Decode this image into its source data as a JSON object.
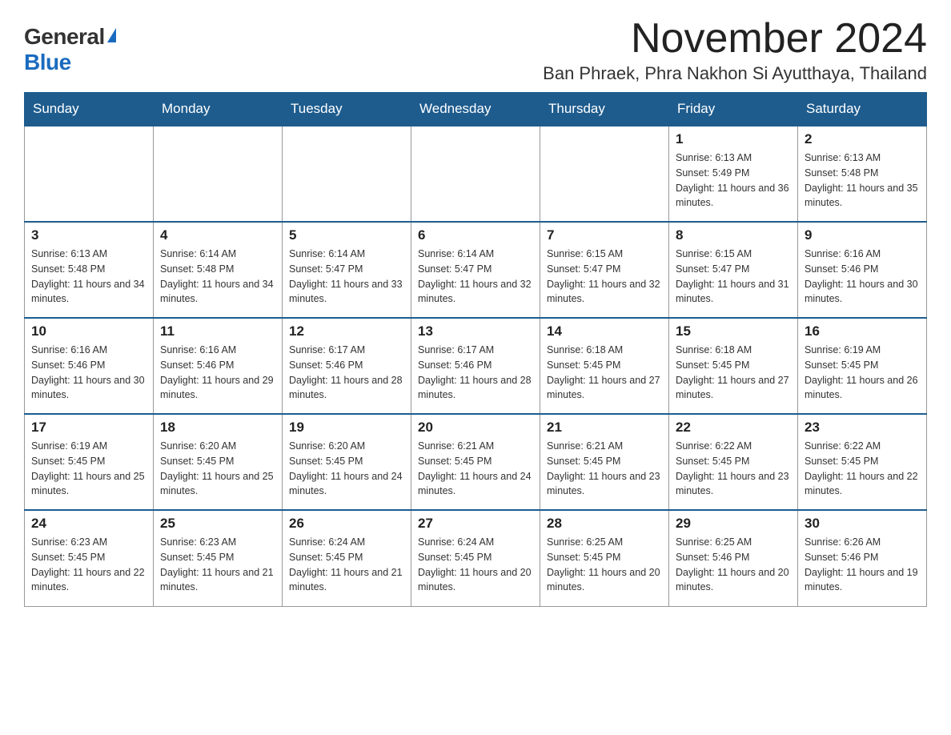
{
  "header": {
    "logo_general": "General",
    "logo_blue": "Blue",
    "month_title": "November 2024",
    "location": "Ban Phraek, Phra Nakhon Si Ayutthaya, Thailand"
  },
  "days_of_week": [
    "Sunday",
    "Monday",
    "Tuesday",
    "Wednesday",
    "Thursday",
    "Friday",
    "Saturday"
  ],
  "weeks": [
    {
      "days": [
        {
          "num": "",
          "info": ""
        },
        {
          "num": "",
          "info": ""
        },
        {
          "num": "",
          "info": ""
        },
        {
          "num": "",
          "info": ""
        },
        {
          "num": "",
          "info": ""
        },
        {
          "num": "1",
          "info": "Sunrise: 6:13 AM\nSunset: 5:49 PM\nDaylight: 11 hours and 36 minutes."
        },
        {
          "num": "2",
          "info": "Sunrise: 6:13 AM\nSunset: 5:48 PM\nDaylight: 11 hours and 35 minutes."
        }
      ]
    },
    {
      "days": [
        {
          "num": "3",
          "info": "Sunrise: 6:13 AM\nSunset: 5:48 PM\nDaylight: 11 hours and 34 minutes."
        },
        {
          "num": "4",
          "info": "Sunrise: 6:14 AM\nSunset: 5:48 PM\nDaylight: 11 hours and 34 minutes."
        },
        {
          "num": "5",
          "info": "Sunrise: 6:14 AM\nSunset: 5:47 PM\nDaylight: 11 hours and 33 minutes."
        },
        {
          "num": "6",
          "info": "Sunrise: 6:14 AM\nSunset: 5:47 PM\nDaylight: 11 hours and 32 minutes."
        },
        {
          "num": "7",
          "info": "Sunrise: 6:15 AM\nSunset: 5:47 PM\nDaylight: 11 hours and 32 minutes."
        },
        {
          "num": "8",
          "info": "Sunrise: 6:15 AM\nSunset: 5:47 PM\nDaylight: 11 hours and 31 minutes."
        },
        {
          "num": "9",
          "info": "Sunrise: 6:16 AM\nSunset: 5:46 PM\nDaylight: 11 hours and 30 minutes."
        }
      ]
    },
    {
      "days": [
        {
          "num": "10",
          "info": "Sunrise: 6:16 AM\nSunset: 5:46 PM\nDaylight: 11 hours and 30 minutes."
        },
        {
          "num": "11",
          "info": "Sunrise: 6:16 AM\nSunset: 5:46 PM\nDaylight: 11 hours and 29 minutes."
        },
        {
          "num": "12",
          "info": "Sunrise: 6:17 AM\nSunset: 5:46 PM\nDaylight: 11 hours and 28 minutes."
        },
        {
          "num": "13",
          "info": "Sunrise: 6:17 AM\nSunset: 5:46 PM\nDaylight: 11 hours and 28 minutes."
        },
        {
          "num": "14",
          "info": "Sunrise: 6:18 AM\nSunset: 5:45 PM\nDaylight: 11 hours and 27 minutes."
        },
        {
          "num": "15",
          "info": "Sunrise: 6:18 AM\nSunset: 5:45 PM\nDaylight: 11 hours and 27 minutes."
        },
        {
          "num": "16",
          "info": "Sunrise: 6:19 AM\nSunset: 5:45 PM\nDaylight: 11 hours and 26 minutes."
        }
      ]
    },
    {
      "days": [
        {
          "num": "17",
          "info": "Sunrise: 6:19 AM\nSunset: 5:45 PM\nDaylight: 11 hours and 25 minutes."
        },
        {
          "num": "18",
          "info": "Sunrise: 6:20 AM\nSunset: 5:45 PM\nDaylight: 11 hours and 25 minutes."
        },
        {
          "num": "19",
          "info": "Sunrise: 6:20 AM\nSunset: 5:45 PM\nDaylight: 11 hours and 24 minutes."
        },
        {
          "num": "20",
          "info": "Sunrise: 6:21 AM\nSunset: 5:45 PM\nDaylight: 11 hours and 24 minutes."
        },
        {
          "num": "21",
          "info": "Sunrise: 6:21 AM\nSunset: 5:45 PM\nDaylight: 11 hours and 23 minutes."
        },
        {
          "num": "22",
          "info": "Sunrise: 6:22 AM\nSunset: 5:45 PM\nDaylight: 11 hours and 23 minutes."
        },
        {
          "num": "23",
          "info": "Sunrise: 6:22 AM\nSunset: 5:45 PM\nDaylight: 11 hours and 22 minutes."
        }
      ]
    },
    {
      "days": [
        {
          "num": "24",
          "info": "Sunrise: 6:23 AM\nSunset: 5:45 PM\nDaylight: 11 hours and 22 minutes."
        },
        {
          "num": "25",
          "info": "Sunrise: 6:23 AM\nSunset: 5:45 PM\nDaylight: 11 hours and 21 minutes."
        },
        {
          "num": "26",
          "info": "Sunrise: 6:24 AM\nSunset: 5:45 PM\nDaylight: 11 hours and 21 minutes."
        },
        {
          "num": "27",
          "info": "Sunrise: 6:24 AM\nSunset: 5:45 PM\nDaylight: 11 hours and 20 minutes."
        },
        {
          "num": "28",
          "info": "Sunrise: 6:25 AM\nSunset: 5:45 PM\nDaylight: 11 hours and 20 minutes."
        },
        {
          "num": "29",
          "info": "Sunrise: 6:25 AM\nSunset: 5:46 PM\nDaylight: 11 hours and 20 minutes."
        },
        {
          "num": "30",
          "info": "Sunrise: 6:26 AM\nSunset: 5:46 PM\nDaylight: 11 hours and 19 minutes."
        }
      ]
    }
  ]
}
